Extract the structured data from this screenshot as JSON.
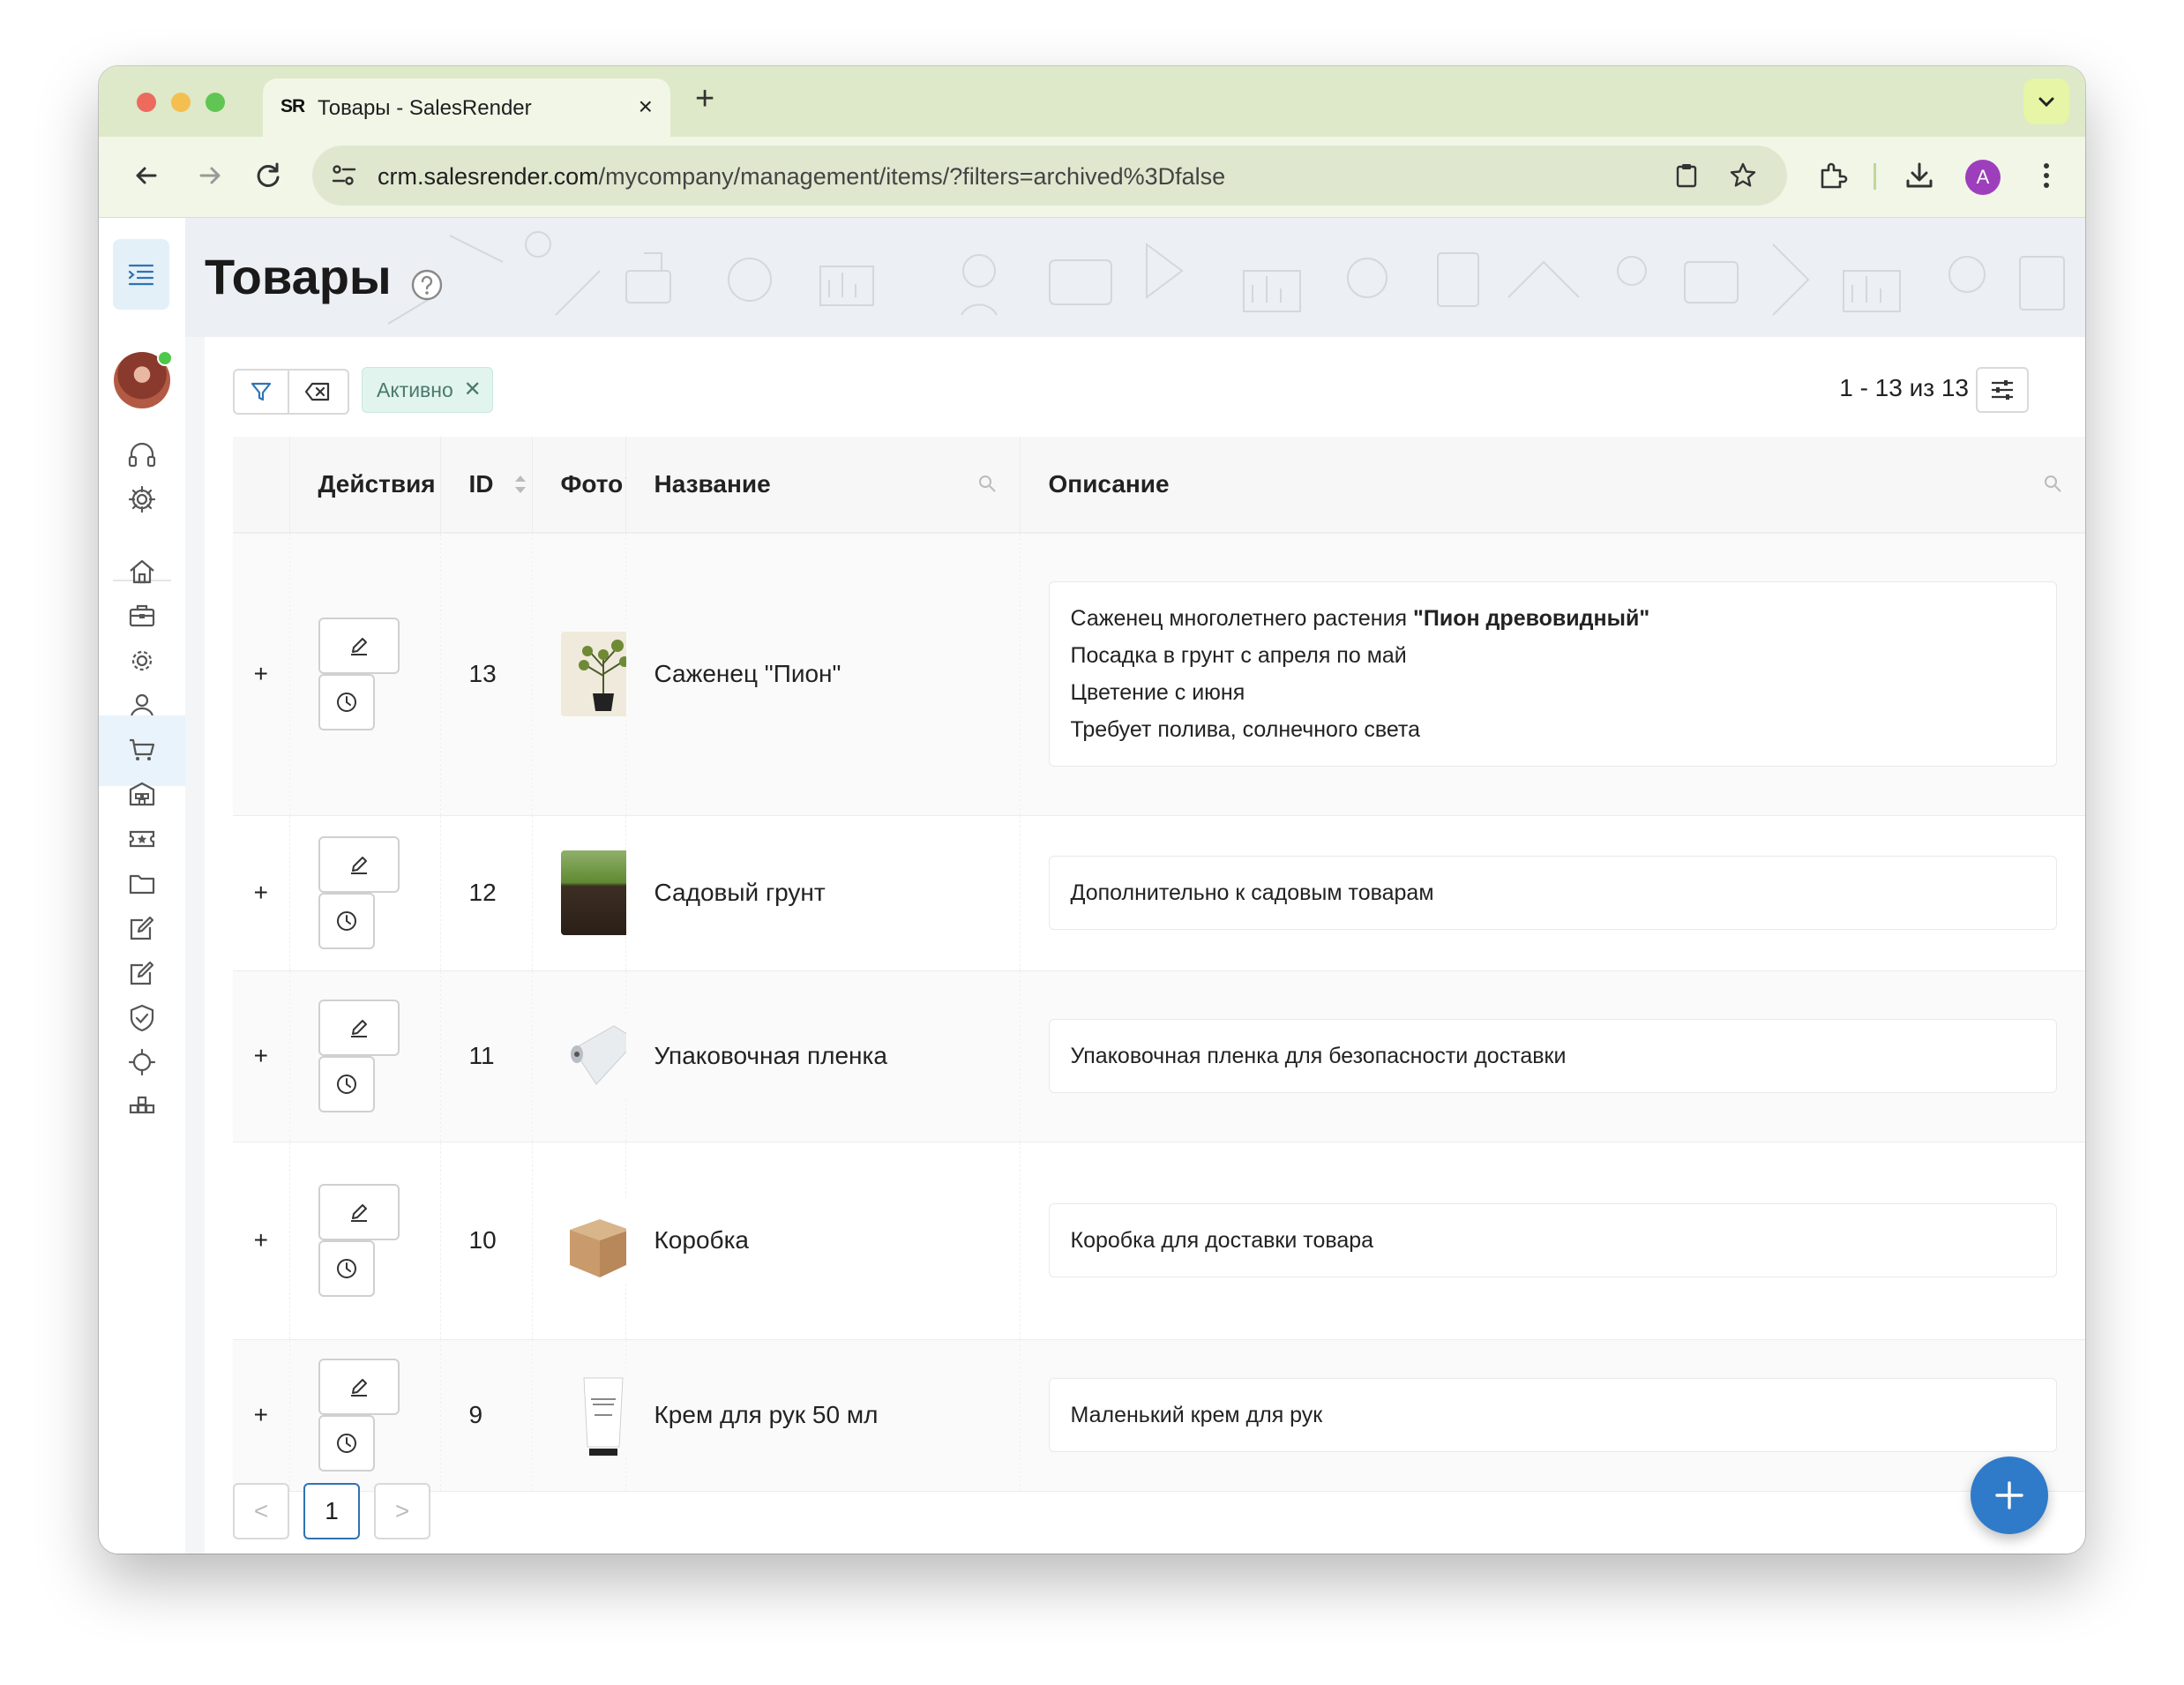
{
  "browser": {
    "tab_title": "Товары - SalesRender",
    "tab_favicon": "SR",
    "url_host": "crm.salesrender.com",
    "url_path": "/mycompany/management/items/?filters=archived%3Dfalse",
    "profile_initial": "A",
    "icons": [
      "back-icon",
      "forward-icon",
      "reload-icon",
      "site-settings-icon",
      "clipboard-icon",
      "bookmark-star-icon",
      "extensions-icon",
      "download-icon",
      "menu-dots-icon"
    ]
  },
  "sidebar": {
    "icons": [
      "menu-toggle-icon",
      "headset-icon",
      "settings-icon",
      "home-icon",
      "briefcase-icon",
      "gear-icon",
      "user-icon",
      "cart-icon",
      "warehouse-icon",
      "ticket-icon",
      "folder-icon",
      "edit-document-icon",
      "edit-document-icon",
      "shield-check-icon",
      "crosshair-icon",
      "blocks-icon"
    ],
    "active": "cart-icon"
  },
  "page": {
    "title": "Товары"
  },
  "filters": {
    "chip_label": "Активно",
    "range_text": "1 - 13 из 13"
  },
  "table": {
    "columns": {
      "actions": "Действия",
      "id": "ID",
      "photo": "Фото",
      "name": "Название",
      "description": "Описание"
    },
    "rows": [
      {
        "id": "13",
        "name": "Саженец \"Пион\"",
        "photo": "plant",
        "description_lines": [
          "Саженец многолетнего растения ",
          "\"Пион древовидный\"",
          "Посадка в грунт с апреля по май",
          "Цветение с июня",
          "Требует полива, солнечного света"
        ]
      },
      {
        "id": "12",
        "name": "Садовый грунт",
        "photo": "soil",
        "description": "Дополнительно к садовым товарам"
      },
      {
        "id": "11",
        "name": "Упаковочная пленка",
        "photo": "wrap",
        "description": "Упаковочная пленка для безопасности доставки"
      },
      {
        "id": "10",
        "name": "Коробка",
        "photo": "box",
        "description": "Коробка для доставки товара"
      },
      {
        "id": "9",
        "name": "Крем для рук 50 мл",
        "photo": "cream",
        "description": "Маленький крем для рук"
      }
    ]
  },
  "pagination": {
    "current": "1",
    "prev": "<",
    "next": ">"
  },
  "colors": {
    "browser_chrome": "#dde9c8",
    "accent_blue": "#2f7bc9",
    "chip_bg": "#e2f4ee"
  }
}
